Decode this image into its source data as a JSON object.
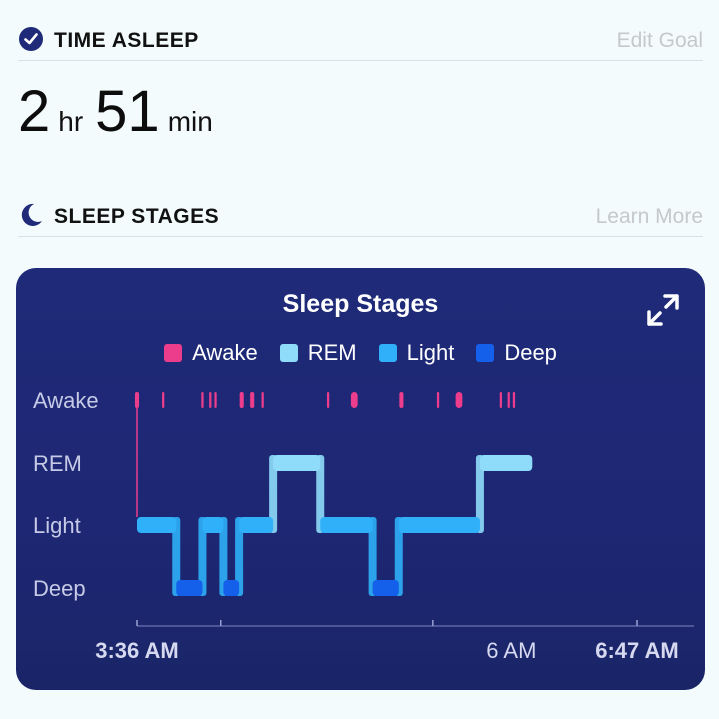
{
  "time_asleep": {
    "title": "TIME ASLEEP",
    "link": "Edit Goal",
    "hours": "2",
    "hours_unit": "hr",
    "minutes": "51",
    "minutes_unit": "min"
  },
  "sleep_stages_section": {
    "title": "SLEEP STAGES",
    "link": "Learn More"
  },
  "colors": {
    "awake": "#ec3c8c",
    "rem": "#8fdcfa",
    "light": "#2fb0f8",
    "deep": "#1560ea",
    "card_bg": "#1f2a78",
    "icon": "#1f2a78"
  },
  "icons": {
    "time": "clock-check-icon",
    "stages": "moon-icon",
    "expand": "expand-arrows-icon"
  },
  "chart_data": {
    "type": "line",
    "title": "Sleep Stages",
    "legend": [
      "Awake",
      "REM",
      "Light",
      "Deep"
    ],
    "legend_position": "top",
    "y_categories": [
      "Awake",
      "REM",
      "Light",
      "Deep"
    ],
    "x_ticks": [
      "3:36 AM",
      "6 AM",
      "6:47 AM"
    ],
    "x_range_minutes": [
      0,
      191
    ],
    "stage_timeline": [
      {
        "stage": "Light",
        "start": 0,
        "end": 15
      },
      {
        "stage": "Deep",
        "start": 15,
        "end": 25
      },
      {
        "stage": "Light",
        "start": 25,
        "end": 33
      },
      {
        "stage": "Deep",
        "start": 33,
        "end": 39
      },
      {
        "stage": "Light",
        "start": 39,
        "end": 52
      },
      {
        "stage": "REM",
        "start": 52,
        "end": 70
      },
      {
        "stage": "Light",
        "start": 70,
        "end": 90
      },
      {
        "stage": "Deep",
        "start": 90,
        "end": 100
      },
      {
        "stage": "Light",
        "start": 100,
        "end": 131
      },
      {
        "stage": "REM",
        "start": 131,
        "end": 151
      }
    ],
    "awake_marks": [
      {
        "time": 0,
        "duration": 1
      },
      {
        "time": 10,
        "duration": 0.3
      },
      {
        "time": 25,
        "duration": 0.3
      },
      {
        "time": 28,
        "duration": 0.3
      },
      {
        "time": 30,
        "duration": 0.3
      },
      {
        "time": 40,
        "duration": 1
      },
      {
        "time": 44,
        "duration": 1
      },
      {
        "time": 48,
        "duration": 0.3
      },
      {
        "time": 73,
        "duration": 0.3
      },
      {
        "time": 83,
        "duration": 2
      },
      {
        "time": 101,
        "duration": 1
      },
      {
        "time": 115,
        "duration": 0.3
      },
      {
        "time": 123,
        "duration": 2
      },
      {
        "time": 139,
        "duration": 0.3
      },
      {
        "time": 142,
        "duration": 0.3
      },
      {
        "time": 144,
        "duration": 0.3
      }
    ]
  }
}
